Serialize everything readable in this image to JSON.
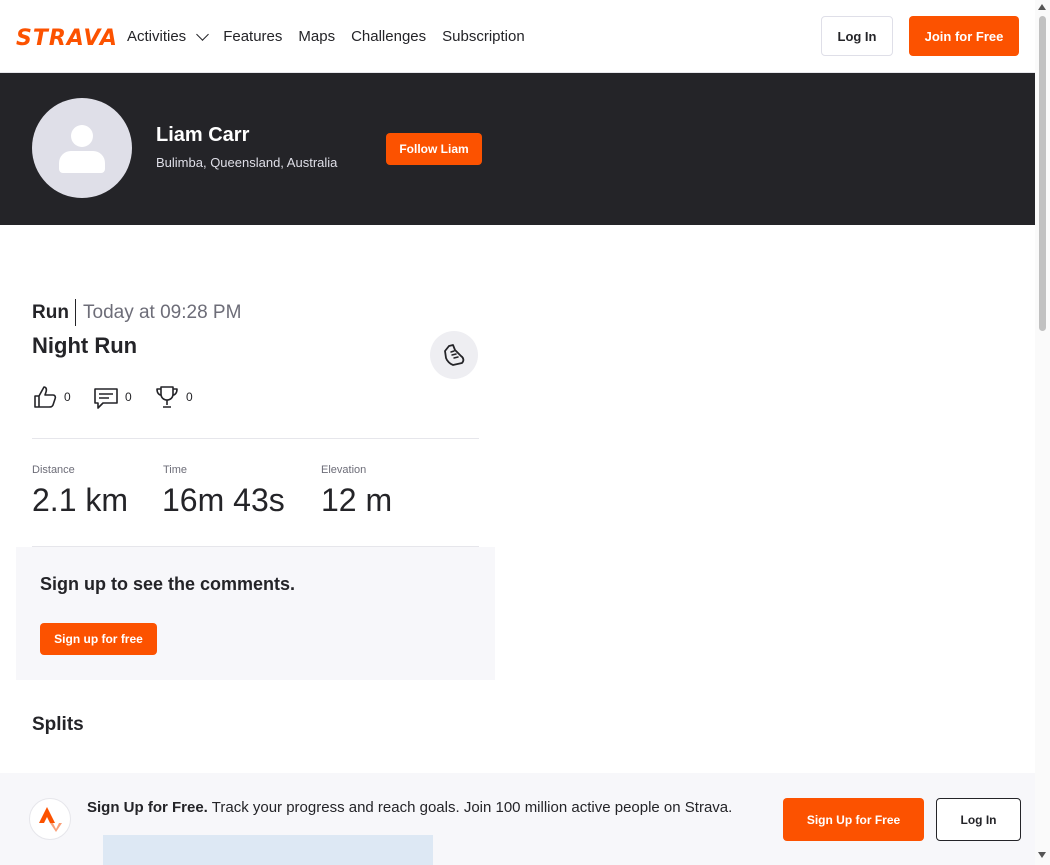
{
  "nav": {
    "logo": "STRAVA",
    "items": [
      {
        "label": "Activities",
        "dropdown": true
      },
      {
        "label": "Features"
      },
      {
        "label": "Maps"
      },
      {
        "label": "Challenges"
      },
      {
        "label": "Subscription"
      }
    ],
    "login_label": "Log In",
    "join_label": "Join for Free"
  },
  "profile": {
    "name": "Liam Carr",
    "location": "Bulimba, Queensland, Australia",
    "follow_label": "Follow Liam"
  },
  "activity": {
    "type": "Run",
    "time": "Today at 09:28 PM",
    "name": "Night Run",
    "kudos": "0",
    "comments": "0",
    "achievements": "0",
    "stats": [
      {
        "label": "Distance",
        "value": "2.1 km"
      },
      {
        "label": "Time",
        "value": "16m 43s"
      },
      {
        "label": "Elevation",
        "value": "12 m"
      }
    ]
  },
  "comments": {
    "title": "Sign up to see the comments.",
    "signup_label": "Sign up for free"
  },
  "splits": {
    "title": "Splits"
  },
  "banner": {
    "headline": "Sign Up for Free.",
    "text": "Track your progress and reach goals. Join 100 million active people on Strava.",
    "signup_label": "Sign Up for Free",
    "login_label": "Log In"
  },
  "colors": {
    "brand": "#fc5200",
    "header_bg": "#242428"
  }
}
